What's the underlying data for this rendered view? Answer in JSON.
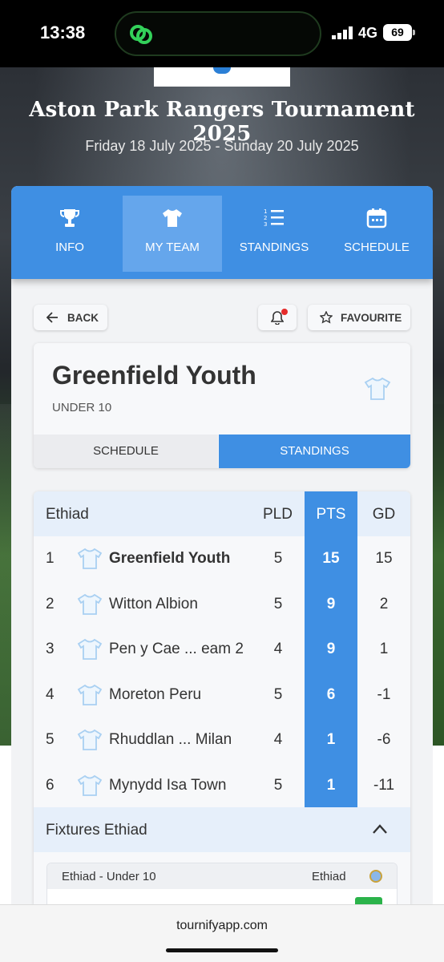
{
  "status_bar": {
    "time": "13:38",
    "network": "4G",
    "battery": "69"
  },
  "tournament": {
    "title": "Aston Park Rangers Tournament 2025",
    "dates": "Friday 18 July 2025 - Sunday 20 July 2025"
  },
  "nav": {
    "tabs": [
      {
        "label": "INFO",
        "icon": "trophy-icon"
      },
      {
        "label": "MY TEAM",
        "icon": "shirt-icon",
        "active": true
      },
      {
        "label": "STANDINGS",
        "icon": "numbered-list-icon"
      },
      {
        "label": "SCHEDULE",
        "icon": "calendar-icon"
      }
    ]
  },
  "actions": {
    "back_label": "BACK",
    "favourite_label": "FAVOURITE"
  },
  "team": {
    "name": "Greenfield Youth",
    "age_group": "UNDER 10"
  },
  "team_tabs": {
    "schedule": "SCHEDULE",
    "standings": "STANDINGS",
    "active": "standings"
  },
  "standings": {
    "group": "Ethiad",
    "headers": {
      "pld": "PLD",
      "pts": "PTS",
      "gd": "GD"
    },
    "rows": [
      {
        "pos": "1",
        "team": "Greenfield Youth",
        "pld": "5",
        "pts": "15",
        "gd": "15"
      },
      {
        "pos": "2",
        "team": "Witton Albion",
        "pld": "5",
        "pts": "9",
        "gd": "2"
      },
      {
        "pos": "3",
        "team": "Pen y Cae ... eam 2",
        "pld": "4",
        "pts": "9",
        "gd": "1"
      },
      {
        "pos": "4",
        "team": "Moreton Peru",
        "pld": "5",
        "pts": "6",
        "gd": "-1"
      },
      {
        "pos": "5",
        "team": "Rhuddlan ...  Milan",
        "pld": "4",
        "pts": "1",
        "gd": "-6"
      },
      {
        "pos": "6",
        "team": "Mynydd Isa Town",
        "pld": "5",
        "pts": "1",
        "gd": "-11"
      }
    ]
  },
  "fixtures": {
    "header": "Fixtures Ethiad",
    "card_title": "Ethiad - Under 10",
    "card_group": "Ethiad"
  },
  "browser": {
    "url": "tournifyapp.com"
  },
  "colors": {
    "primary": "#3f8fe3",
    "active_tab": "#65a6ec",
    "notification_dot": "#e52b2b"
  }
}
